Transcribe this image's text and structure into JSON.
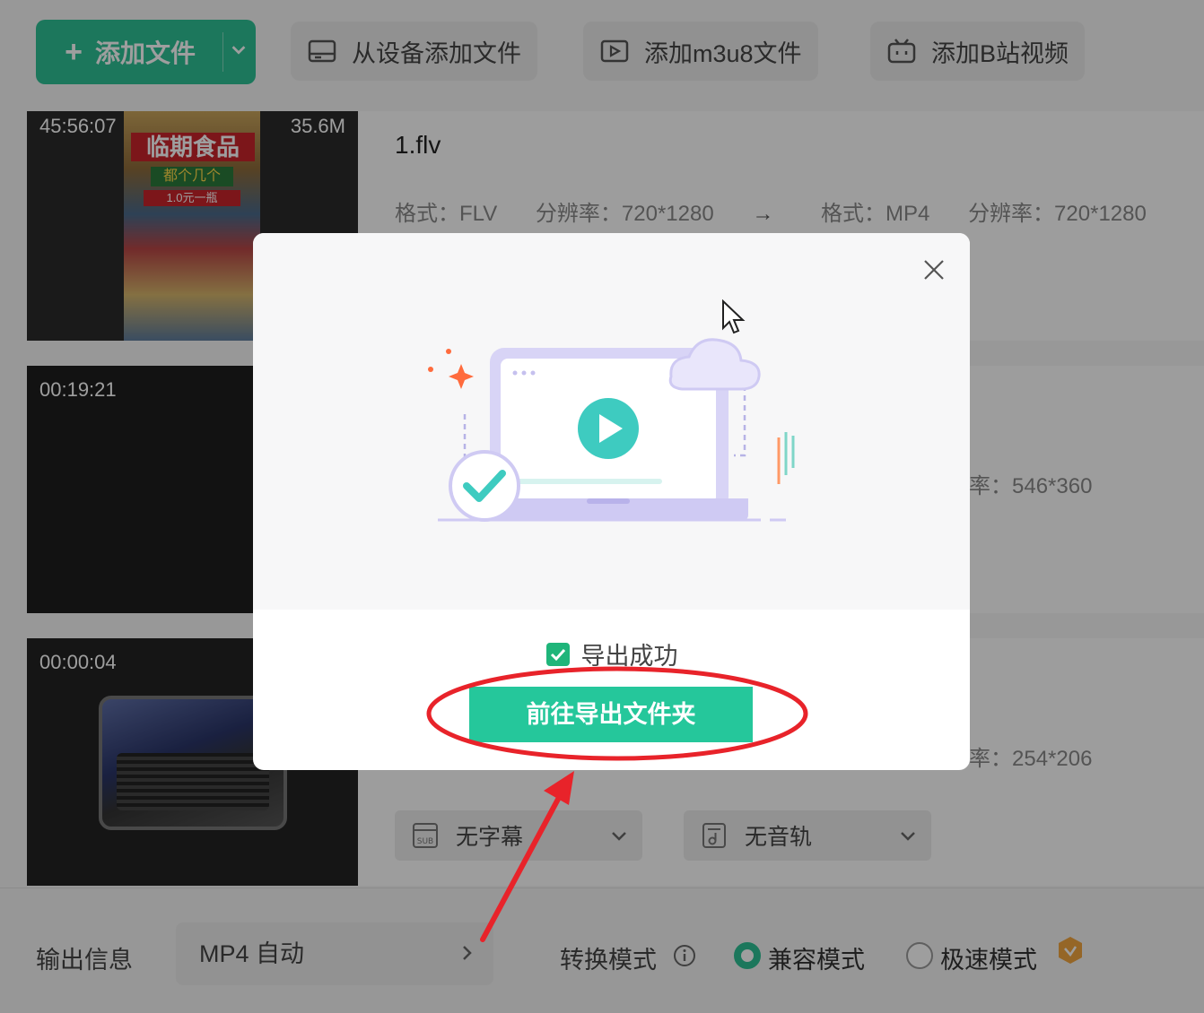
{
  "toolbar": {
    "add_file_label": "添加文件",
    "device_label": "从设备添加文件",
    "m3u8_label": "添加m3u8文件",
    "bili_label": "添加B站视频"
  },
  "files": [
    {
      "name": "1.flv",
      "duration": "45:56:07",
      "size": "35.6M",
      "src_format": "格式：FLV",
      "src_res": "分辨率：720*1280",
      "arrow": "→",
      "dst_format": "格式：MP4",
      "dst_res": "分辨率：720*1280",
      "poster_title": "临期食品",
      "poster_sub": "都个几个",
      "poster_tag": "1.0元一瓶"
    },
    {
      "duration": "00:19:21",
      "res_partial": "率：546*360"
    },
    {
      "duration": "00:00:04",
      "res_partial": "率：254*206"
    }
  ],
  "row3_controls": {
    "subtitle_label": "无字幕",
    "audio_label": "无音轨"
  },
  "bottom": {
    "output_label": "输出信息",
    "output_value": "MP4 自动",
    "mode_label": "转换模式",
    "mode_compat": "兼容模式",
    "mode_fast": "极速模式"
  },
  "modal": {
    "success_text": "导出成功",
    "button_label": "前往导出文件夹"
  },
  "colors": {
    "accent": "#2ec195",
    "modal_button": "#25c79b",
    "annotation": "#e8232a"
  }
}
